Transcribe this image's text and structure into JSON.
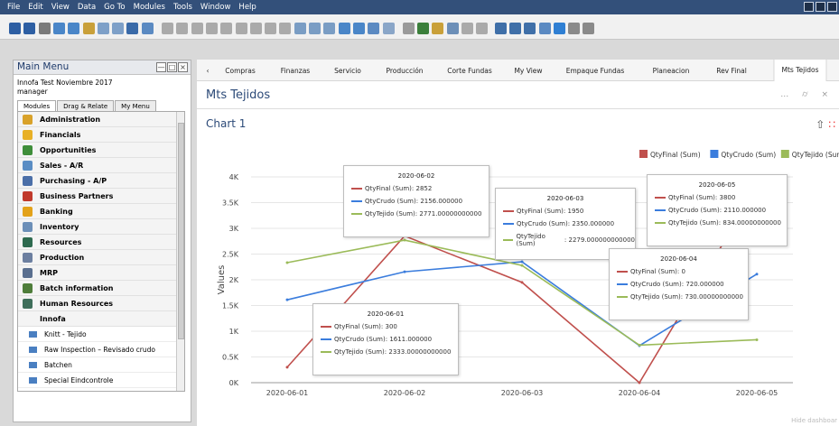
{
  "menubar": {
    "items": [
      "File",
      "Edit",
      "View",
      "Data",
      "Go To",
      "Modules",
      "Tools",
      "Window",
      "Help"
    ]
  },
  "main_menu": {
    "title": "Main Menu",
    "company": "Innofa Test Noviembre 2017",
    "user": "manager",
    "tabs": [
      "Modules",
      "Drag & Relate",
      "My Menu"
    ],
    "modules": [
      {
        "label": "Administration",
        "icon": "admin-icon",
        "color": "#d9a22a"
      },
      {
        "label": "Financials",
        "icon": "financials-icon",
        "color": "#e8b026"
      },
      {
        "label": "Opportunities",
        "icon": "opportunities-icon",
        "color": "#3f8e3a"
      },
      {
        "label": "Sales - A/R",
        "icon": "sales-icon",
        "color": "#5a8dc4"
      },
      {
        "label": "Purchasing - A/P",
        "icon": "cart-icon",
        "color": "#4b6fa8"
      },
      {
        "label": "Business Partners",
        "icon": "partners-icon",
        "color": "#c0392b"
      },
      {
        "label": "Banking",
        "icon": "bank-icon",
        "color": "#e3a21a"
      },
      {
        "label": "Inventory",
        "icon": "inventory-icon",
        "color": "#6c8fb8"
      },
      {
        "label": "Resources",
        "icon": "resources-icon",
        "color": "#2e6a4f"
      },
      {
        "label": "Production",
        "icon": "production-icon",
        "color": "#6c7fa0"
      },
      {
        "label": "MRP",
        "icon": "mrp-icon",
        "color": "#5a6f8f"
      },
      {
        "label": "Batch information",
        "icon": "batch-icon",
        "color": "#4e7d3a"
      },
      {
        "label": "Human Resources",
        "icon": "hr-icon",
        "color": "#3e6e5a"
      }
    ],
    "group": "Innofa",
    "sub_items": [
      "Knitt - Tejido",
      "Raw Inspection – Revisado crudo",
      "Batchen",
      "Special Eindcontrole"
    ]
  },
  "tabs": [
    "Compras",
    "Finanzas",
    "Servicio",
    "Producción",
    "Corte Fundas",
    "My View",
    "Empaque Fundas",
    "Planeacion",
    "Rev Final",
    "Mts Tejidos"
  ],
  "active_tab": "Mts Tejidos",
  "panel": {
    "title": "Mts Tejidos",
    "chart_title": "Chart 1"
  },
  "footer": {
    "hide": "Hide dashboar"
  },
  "chart_data": {
    "type": "line",
    "categories": [
      "2020-06-01",
      "2020-06-02",
      "2020-06-03",
      "2020-06-04",
      "2020-06-05"
    ],
    "ylabel": "Values",
    "ylim": [
      0,
      4000
    ],
    "yticks": [
      "0K",
      "0.5K",
      "1K",
      "1.5K",
      "2K",
      "2.5K",
      "3K",
      "3.5K",
      "4K"
    ],
    "legend_position": "top-right",
    "grid": true,
    "series": [
      {
        "name": "QtyFinal (Sum)",
        "color": "#c0504d",
        "values": [
          300,
          2852,
          1950,
          0,
          3800
        ],
        "labels": [
          "300",
          "2852",
          "1950",
          "0",
          "3800"
        ]
      },
      {
        "name": "QtyCrudo (Sum)",
        "color": "#3b7ddd",
        "values": [
          1611,
          2156,
          2350,
          720,
          2110
        ],
        "labels": [
          "1611.000000",
          "2156.000000",
          "2350.000000",
          "720.000000",
          "2110.000000"
        ]
      },
      {
        "name": "QtyTejido (Sum)",
        "color": "#9bbb59",
        "values": [
          2333,
          2771,
          2279,
          730,
          834
        ],
        "labels": [
          "2333.00000000000",
          "2771.00000000000",
          "2279.000000000000",
          "730.00000000000",
          "834.00000000000"
        ]
      }
    ]
  }
}
